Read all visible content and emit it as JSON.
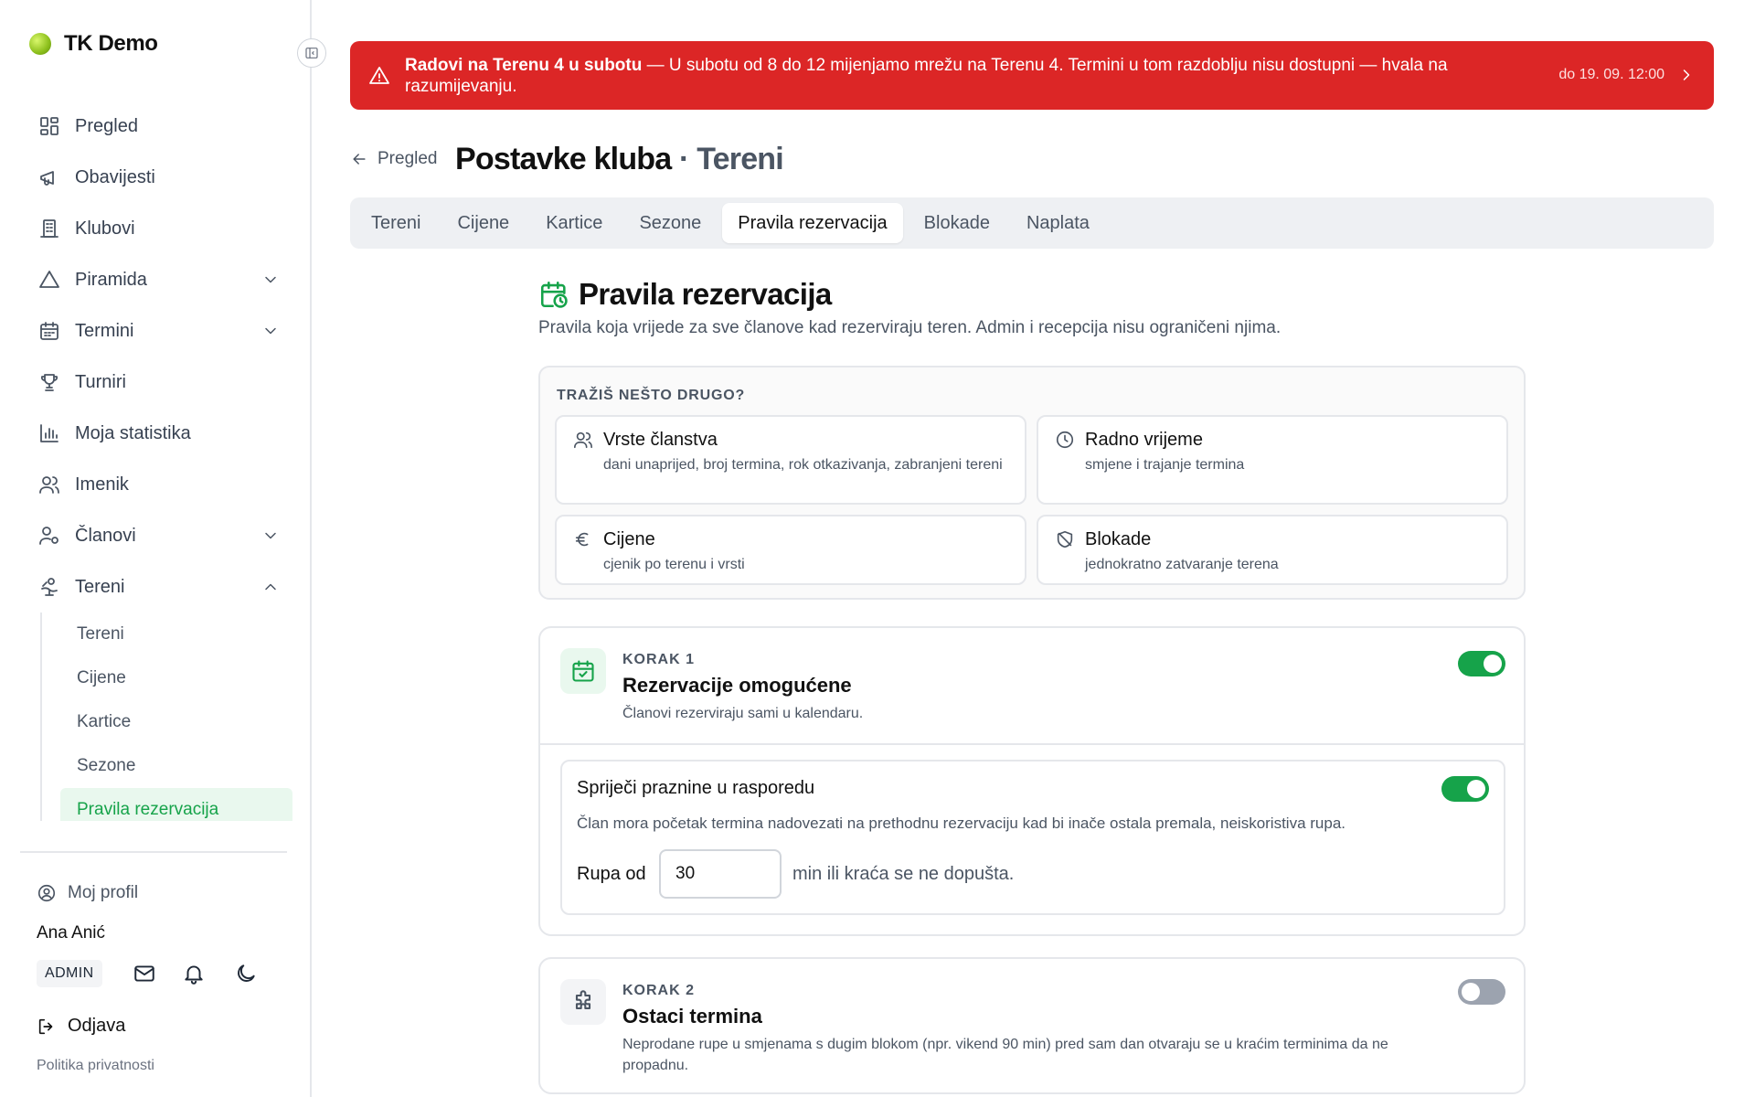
{
  "app": {
    "name": "TK Demo"
  },
  "sidebar": {
    "items": [
      {
        "label": "Pregled",
        "icon": "dashboard-icon"
      },
      {
        "label": "Obavijesti",
        "icon": "megaphone-icon"
      },
      {
        "label": "Klubovi",
        "icon": "building-icon"
      },
      {
        "label": "Piramida",
        "icon": "triangle-icon",
        "expandable": true
      },
      {
        "label": "Termini",
        "icon": "calendar-icon",
        "expandable": true
      },
      {
        "label": "Turniri",
        "icon": "trophy-icon"
      },
      {
        "label": "Moja statistika",
        "icon": "bar-chart-icon"
      },
      {
        "label": "Imenik",
        "icon": "users-icon"
      },
      {
        "label": "Članovi",
        "icon": "user-cog-icon",
        "expandable": true
      },
      {
        "label": "Tereni",
        "icon": "court-icon",
        "expanded": true
      }
    ],
    "subitems": [
      "Tereni",
      "Cijene",
      "Kartice",
      "Sezone",
      "Pravila rezervacija"
    ],
    "active_subitem": "Pravila rezervacija"
  },
  "profile": {
    "link_label": "Moj profil",
    "user_name": "Ana Anić",
    "role": "ADMIN",
    "logout_label": "Odjava",
    "privacy_label": "Politika privatnosti"
  },
  "banner": {
    "title": "Radovi na Terenu 4 u subotu",
    "message": " — U subotu od 8 do 12 mijenjamo mrežu na Terenu 4. Termini u tom razdoblju nisu dostupni — hvala na razumijevanju.",
    "until": "do 19. 09. 12:00",
    "color": "#dc2626"
  },
  "header": {
    "back_label": "Pregled",
    "title": "Postavke kluba",
    "separator": " · ",
    "subtitle": "Tereni"
  },
  "tabs": [
    {
      "label": "Tereni",
      "active": false
    },
    {
      "label": "Cijene",
      "active": false
    },
    {
      "label": "Kartice",
      "active": false
    },
    {
      "label": "Sezone",
      "active": false
    },
    {
      "label": "Pravila rezervacija",
      "active": true
    },
    {
      "label": "Blokade",
      "active": false
    },
    {
      "label": "Naplata",
      "active": false
    }
  ],
  "section": {
    "title": "Pravila rezervacija",
    "description": "Pravila koja vrijede za sve članove kad rezerviraju teren. Admin i recepcija nisu ograničeni njima."
  },
  "other": {
    "title": "TRAŽIŠ NEŠTO DRUGO?",
    "cards": [
      {
        "title": "Vrste članstva",
        "desc": "dani unaprijed, broj termina, rok otkazivanja, zabranjeni tereni",
        "icon": "users-icon"
      },
      {
        "title": "Radno vrijeme",
        "desc": "smjene i trajanje termina",
        "icon": "clock-icon"
      },
      {
        "title": "Cijene",
        "desc": "cjenik po terenu i vrsti",
        "icon": "euro-icon"
      },
      {
        "title": "Blokade",
        "desc": "jednokratno zatvaranje terena",
        "icon": "shield-off-icon"
      }
    ]
  },
  "step1": {
    "label": "KORAK 1",
    "title": "Rezervacije omogućene",
    "desc": "Članovi rezerviraju sami u kalendaru.",
    "enabled": true,
    "gap_rule": {
      "title": "Spriječi praznine u rasporedu",
      "desc": "Član mora početak termina nadovezati na prethodnu rezervaciju kad bi inače ostala premala, neiskoristiva rupa.",
      "enabled": true,
      "input_label": "Rupa od",
      "value": "30",
      "suffix": "min ili kraća se ne dopušta."
    }
  },
  "step2": {
    "label": "KORAK 2",
    "title": "Ostaci termina",
    "desc": "Neprodane rupe u smjenama s dugim blokom (npr. vikend 90 min) pred sam dan otvaraju se u kraćim terminima da ne propadnu.",
    "enabled": false
  },
  "colors": {
    "accent": "#16a34a",
    "danger": "#dc2626"
  }
}
